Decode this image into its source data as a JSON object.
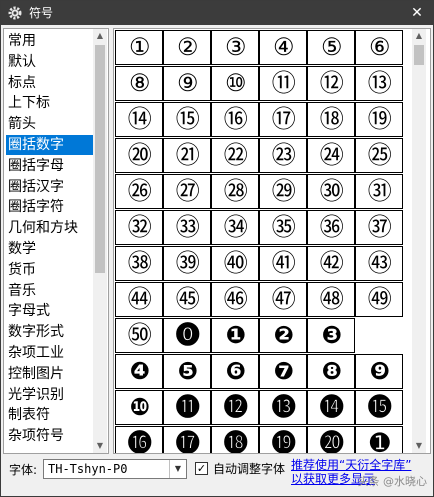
{
  "window": {
    "title": "符号",
    "close_glyph": "✕"
  },
  "categories": {
    "items": [
      "常用",
      "默认",
      "标点",
      "上下标",
      "箭头",
      "圈括数字",
      "圈括字母",
      "圈括汉字",
      "圈括字符",
      "几何和方块",
      "数学",
      "货币",
      "音乐",
      "字母式",
      "数字形式",
      "杂项工业",
      "控制图片",
      "光学识别",
      "制表符",
      "杂项符号"
    ],
    "selected": "圈括数字"
  },
  "symbols": {
    "rows": [
      [
        "①",
        "②",
        "③",
        "④",
        "⑤",
        "⑥"
      ],
      [
        "⑧",
        "⑨",
        "⑩",
        "⑪",
        "⑫",
        "⑬"
      ],
      [
        "⑭",
        "⑮",
        "⑯",
        "⑰",
        "⑱",
        "⑲"
      ],
      [
        "⑳",
        "㉑",
        "㉒",
        "㉓",
        "㉔",
        "㉕"
      ],
      [
        "㉖",
        "㉗",
        "㉘",
        "㉙",
        "㉚",
        "㉛"
      ],
      [
        "㉜",
        "㉝",
        "㉞",
        "㉟",
        "㊱",
        "㊲"
      ],
      [
        "㊳",
        "㊴",
        "㊵",
        "㊶",
        "㊷",
        "㊸"
      ],
      [
        "㊹",
        "㊺",
        "㊻",
        "㊼",
        "㊽",
        "㊾"
      ],
      [
        "㊿",
        "⓿",
        "❶",
        "❷",
        "❸"
      ],
      [
        "❹",
        "❺",
        "❻",
        "❼",
        "❽",
        "❾"
      ],
      [
        "❿",
        "⓫",
        "⓬",
        "⓭",
        "⓮",
        "⓯"
      ],
      [
        "⓰",
        "⓱",
        "⓲",
        "⓳",
        "⓴",
        "➊"
      ]
    ]
  },
  "footer": {
    "font_label": "字体:",
    "font_value": "TH-Tshyn-P0",
    "autofit_label": "自动调整字体",
    "autofit_checked": true,
    "promo_line1": "推荐使用“天衍全字库”",
    "promo_line2": "以获取更多显示",
    "watermark": "头条 @水晓心"
  }
}
